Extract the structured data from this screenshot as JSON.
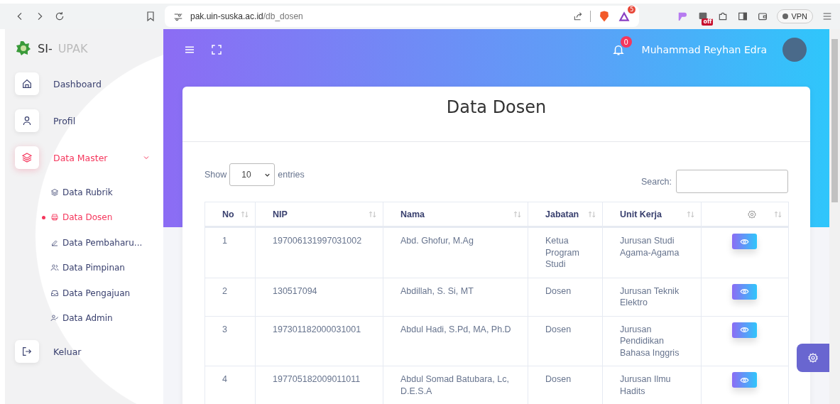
{
  "browser": {
    "url_host": "pak.uin-suska.ac.id",
    "url_path": "/db_dosen",
    "rewards_badge": "5",
    "extension_badge": "off",
    "vpn_label": "VPN"
  },
  "sidebar": {
    "logo_prefix": "SI-",
    "logo_suffix": "UPAK",
    "items": [
      {
        "label": "Dashboard",
        "kind": "home",
        "selected": false
      },
      {
        "label": "Profil",
        "kind": "user",
        "selected": false
      },
      {
        "label": "Data Master",
        "kind": "layers",
        "selected": true,
        "expanded": true,
        "children": [
          {
            "label": "Data Rubrik",
            "kind": "layers",
            "selected": false
          },
          {
            "label": "Data Dosen",
            "kind": "printer",
            "selected": true
          },
          {
            "label": "Data Pembaharu...",
            "kind": "pen",
            "selected": false
          },
          {
            "label": "Data Pimpinan",
            "kind": "users",
            "selected": false
          },
          {
            "label": "Data Pengajuan",
            "kind": "inbox",
            "selected": false
          },
          {
            "label": "Data Admin",
            "kind": "user-check",
            "selected": false
          }
        ]
      },
      {
        "label": "Keluar",
        "kind": "logout",
        "selected": false
      }
    ]
  },
  "header": {
    "notification_count": "0",
    "user_name": "Muhammad Reyhan Edra"
  },
  "card": {
    "title": "Data Dosen",
    "show_label": "Show",
    "page_size": "10",
    "entries_label": "entries",
    "search_label": "Search:"
  },
  "table": {
    "columns": [
      {
        "kind": "text",
        "label": "No"
      },
      {
        "kind": "text",
        "label": "NIP"
      },
      {
        "kind": "text",
        "label": "Nama"
      },
      {
        "kind": "text",
        "label": "Jabatan"
      },
      {
        "kind": "text",
        "label": "Unit Kerja"
      },
      {
        "kind": "gear"
      }
    ],
    "rows": [
      {
        "no": "1",
        "nip": "197006131997031002",
        "nama": "Abd. Ghofur, M.Ag",
        "jabatan": "Ketua Program Studi",
        "unit": "Jurusan Studi Agama-Agama"
      },
      {
        "no": "2",
        "nip": "130517094",
        "nama": "Abdillah, S. Si, MT",
        "jabatan": "Dosen",
        "unit": "Jurusan Teknik Elektro"
      },
      {
        "no": "3",
        "nip": "197301182000031001",
        "nama": "Abdul Hadi, S.Pd, MA, Ph.D",
        "jabatan": "Dosen",
        "unit": "Jurusan Pendidikan Bahasa Inggris"
      },
      {
        "no": "4",
        "nip": "197705182009011011",
        "nama": "Abdul Somad Batubara, Lc, D.E.S.A",
        "jabatan": "Dosen",
        "unit": "Jurusan Ilmu Hadits"
      }
    ]
  }
}
